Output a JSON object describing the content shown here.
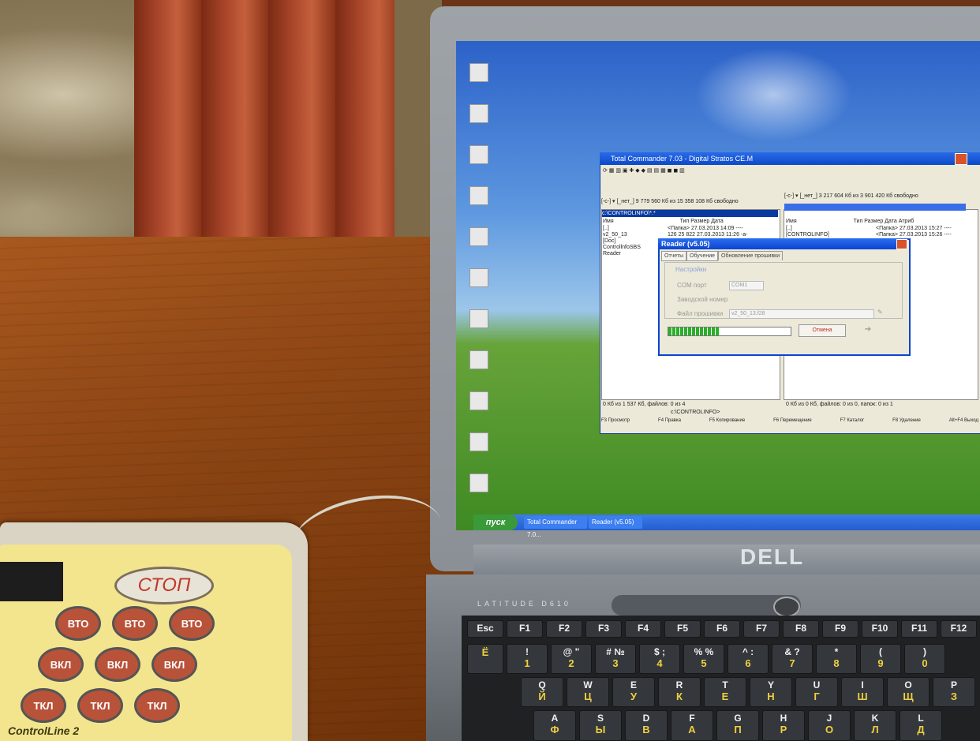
{
  "scene": {
    "desktop": {
      "icons": [
        "",
        "",
        "",
        "",
        "",
        "",
        "",
        "",
        "",
        "",
        ""
      ],
      "start_label": "пуск",
      "taskbar_items": [
        "Total Commander 7.0...",
        "Reader (v5.05)"
      ]
    },
    "total_commander": {
      "title": "Total Commander 7.03 - Digital Stratos CE.M",
      "left_drive": "[-c-] ▾  [_нет_]  9 779 560 Кб из 15 358 108 Кб свободно",
      "right_drive": "[-c-] ▾  [_нет_]  3 217 604 Кб из 3 901 420 Кб свободно",
      "left_path": "c:\\CONTROLINFO\\*.*",
      "columns": [
        "Имя",
        "Тип",
        "Размер",
        "Дата",
        "Атриб"
      ],
      "left_files": [
        "[..]",
        "v2_50_13",
        "[Doc]",
        "ControllnfoSBS",
        "Reader"
      ],
      "left_sizes": [
        "<Папка>  27.03.2013 14:09  ----",
        "126   25 822 27.03.2013 11:26  -a-"
      ],
      "right_files": [
        "[..]",
        "[CONTROLINFO]"
      ],
      "right_sizes": [
        "<Папка> 27.03.2013 15:27  ----",
        "<Папка> 27.03.2013 15:26  ----"
      ],
      "left_status": "0 Кб из 1 537 Кб, файлов: 0 из 4",
      "right_status": "0 Кб из 0 Кб, файлов: 0 из 0, папок: 0 из 1",
      "cmdline": "c:\\CONTROLINFO>",
      "fn_keys": [
        "F3 Просмотр",
        "F4 Правка",
        "F5 Копирование",
        "F6 Перемещение",
        "F7 Каталог",
        "F8 Удаление",
        "Alt+F4 Выход"
      ]
    },
    "reader": {
      "title": "Reader (v5.05)",
      "tabs": [
        "Отчеты",
        "Обучение",
        "Обновление прошивки"
      ],
      "group_label": "Настройки",
      "com_label": "COM порт",
      "com_value": "COM1",
      "serial_label": "Заводской номер",
      "firmware_label": "Файл прошивки",
      "firmware_value": "v2_50_13.f28",
      "stop_label": "Отмена",
      "progress": 0.42
    },
    "laptop": {
      "brand": "DELL",
      "model": "LATITUDE D610"
    },
    "device": {
      "stop_label": "СТОП",
      "keys": [
        "ВТО",
        "ВТО",
        "ВТО",
        "ВКЛ",
        "ВКЛ",
        "ВКЛ",
        "ТКЛ",
        "ТКЛ",
        "ТКЛ"
      ],
      "brand": "ControlLine 2"
    },
    "keyboard": {
      "number_row": [
        [
          "!",
          "1"
        ],
        [
          "@ \"",
          "2"
        ],
        [
          "# №",
          "3"
        ],
        [
          "$ ;",
          "4"
        ],
        [
          "% %",
          "5"
        ],
        [
          "^ :",
          "6"
        ],
        [
          "& ?",
          "7"
        ],
        [
          "*",
          "8"
        ],
        [
          "(",
          "9"
        ],
        [
          ")",
          "0"
        ]
      ],
      "qwerty_row": [
        [
          "Q",
          "Й"
        ],
        [
          "W",
          "Ц"
        ],
        [
          "E",
          "У"
        ],
        [
          "R",
          "К"
        ],
        [
          "T",
          "Е"
        ],
        [
          "Y",
          "Н"
        ],
        [
          "U",
          "Г"
        ],
        [
          "I",
          "Ш"
        ],
        [
          "O",
          "Щ"
        ],
        [
          "P",
          "З"
        ]
      ],
      "asdf_row": [
        [
          "A",
          "Ф"
        ],
        [
          "S",
          "Ы"
        ],
        [
          "D",
          "В"
        ],
        [
          "F",
          "А"
        ],
        [
          "G",
          "П"
        ],
        [
          "H",
          "Р"
        ],
        [
          "J",
          "О"
        ],
        [
          "K",
          "Л"
        ],
        [
          "L",
          "Д"
        ]
      ],
      "fn_row": [
        "Esc",
        "F1",
        "F2",
        "F3",
        "F4",
        "F5",
        "F6",
        "F7",
        "F8",
        "F9",
        "F10",
        "F11",
        "F12"
      ],
      "tilde": "Ё"
    }
  }
}
